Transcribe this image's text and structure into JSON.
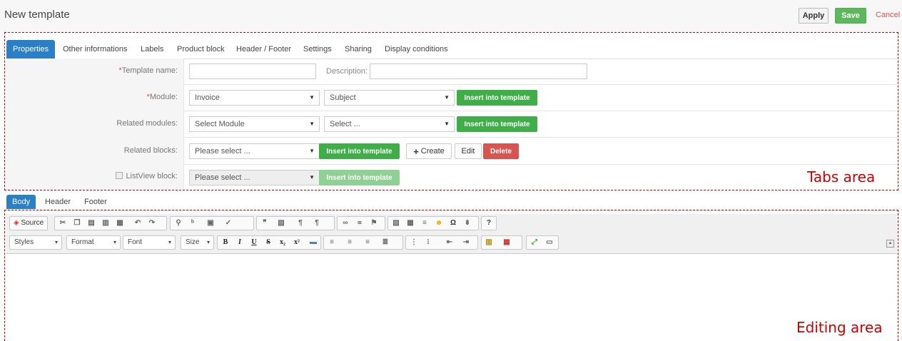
{
  "header": {
    "title": "New template",
    "apply": "Apply",
    "save": "Save",
    "cancel": "Cancel"
  },
  "tabs": [
    "Properties",
    "Other informations",
    "Labels",
    "Product block",
    "Header / Footer",
    "Settings",
    "Sharing",
    "Display conditions"
  ],
  "form": {
    "template_name": {
      "required": "*",
      "label": "Template name:",
      "value": ""
    },
    "description": {
      "label": "Description:",
      "value": ""
    },
    "module": {
      "required": "*",
      "label": "Module:",
      "select": "Invoice",
      "field": "Subject",
      "insert": "Insert into template"
    },
    "related_modules": {
      "label": "Related modules:",
      "select": "Select Module",
      "field": "Select ...",
      "insert": "Insert into template"
    },
    "related_blocks": {
      "label": "Related blocks:",
      "select": "Please select ...",
      "insert": "Insert into template",
      "create": "Create",
      "edit": "Edit",
      "delete": "Delete"
    },
    "listview_block": {
      "label": "ListView block:",
      "select": "Please select ...",
      "insert": "Insert into template"
    }
  },
  "annotations": {
    "tabs_area": "Tabs area",
    "editing_area": "Editing area"
  },
  "body_tabs": [
    "Body",
    "Header",
    "Footer"
  ],
  "editor": {
    "source": "Source",
    "combos": {
      "styles": "Styles",
      "format": "Format",
      "font": "Font",
      "size": "Size"
    },
    "help": "?"
  },
  "colors": {
    "accent": "#2a7fc7",
    "green": "#3fae49",
    "red": "#d9534f",
    "annotation": "#cc0000"
  }
}
